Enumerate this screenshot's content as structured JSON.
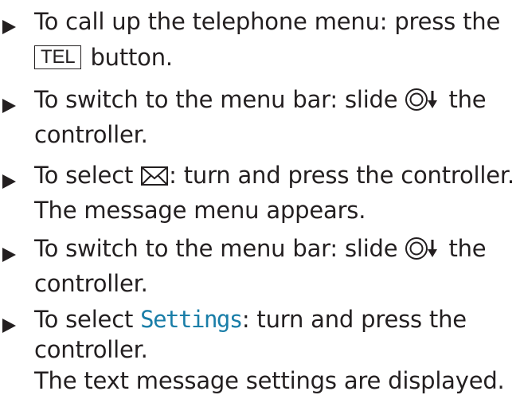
{
  "steps": [
    {
      "line1_text": "To call up the telephone menu: press the",
      "key_label": "TEL",
      "line2_text": " button."
    },
    {
      "line1_before": "To switch to the menu bar: slide ",
      "controller_icon": "controller-slide-down-icon",
      "line1_after": " the",
      "line2_text": "controller."
    },
    {
      "line1_before": "To select ",
      "envelope_icon": "envelope-icon",
      "line1_after": ": turn and press the controller.",
      "line2_text": "The message menu appears."
    },
    {
      "line1_before": "To switch to the menu bar: slide ",
      "controller_icon": "controller-slide-down-icon",
      "line1_after": " the",
      "line2_text": "controller."
    },
    {
      "line1_before": "To select ",
      "menu_term": "Settings",
      "line1_after": ": turn and press the",
      "line2_text": "controller.",
      "line3_text": "The text message settings are displayed."
    }
  ],
  "colors": {
    "text": "#231f20",
    "menu_term": "#1a7ea8"
  }
}
